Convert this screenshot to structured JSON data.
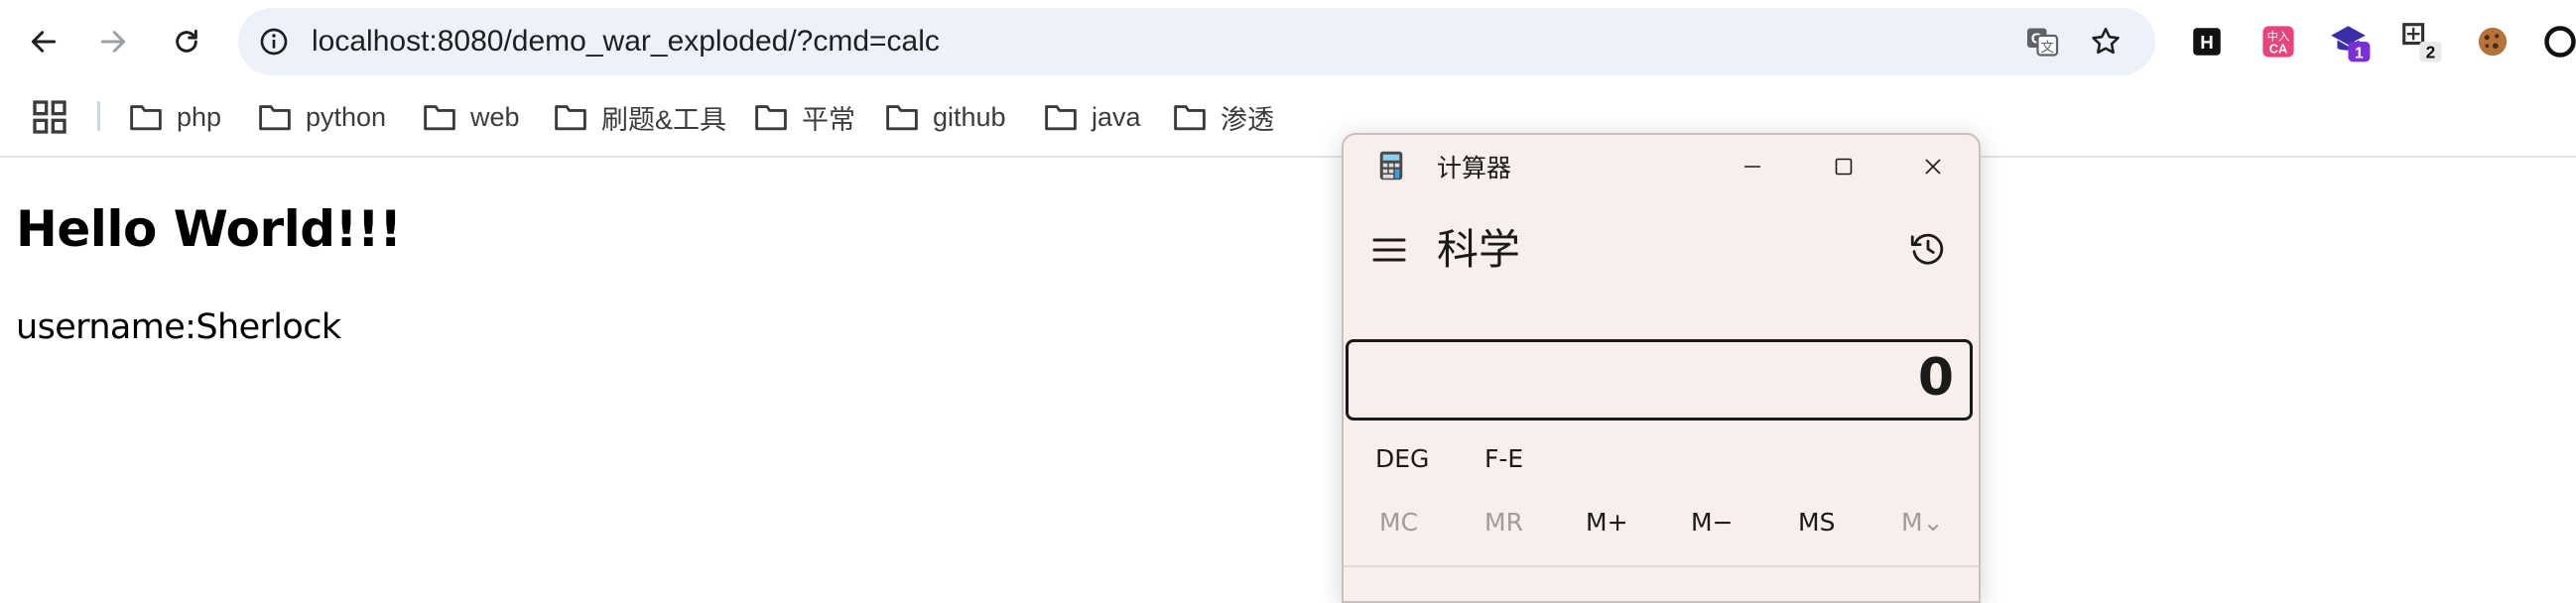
{
  "browser": {
    "url": "localhost:8080/demo_war_exploded/?cmd=calc",
    "extensions": [
      {
        "name": "h-icon",
        "badge": ""
      },
      {
        "name": "translate-ca-icon",
        "badge": ""
      },
      {
        "name": "graduation-cap-icon",
        "badge": "1"
      },
      {
        "name": "puzzle-icon",
        "badge": "2"
      },
      {
        "name": "cookie-icon",
        "badge": ""
      }
    ],
    "bookmarks": [
      "php",
      "python",
      "web",
      "刷题&工具",
      "平常",
      "github",
      "java",
      "渗透"
    ]
  },
  "page": {
    "heading": "Hello World!!!",
    "username_line": "username:Sherlock"
  },
  "calculator": {
    "window_title": "计算器",
    "mode": "科学",
    "display_value": "0",
    "angle_row": [
      "DEG",
      "F-E"
    ],
    "memory_row": [
      {
        "label": "MC",
        "enabled": false
      },
      {
        "label": "MR",
        "enabled": false
      },
      {
        "label": "M+",
        "enabled": true
      },
      {
        "label": "M−",
        "enabled": true
      },
      {
        "label": "MS",
        "enabled": true
      },
      {
        "label": "M⌄",
        "enabled": false
      }
    ]
  },
  "colors": {
    "omnibox_bg": "#edf2fa",
    "calc_bg": "#f8eeeb",
    "badge_purple": "#7b2fd9"
  }
}
